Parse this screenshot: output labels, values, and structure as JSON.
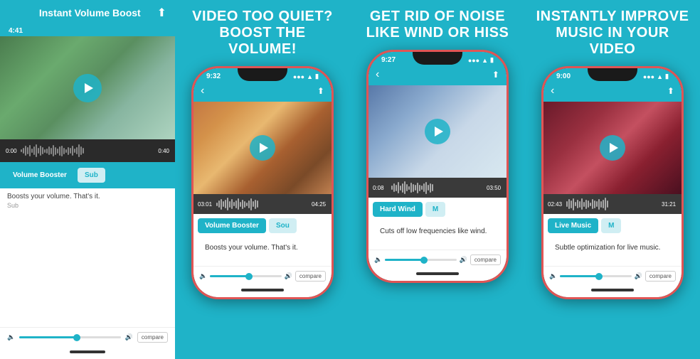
{
  "panels": [
    {
      "id": "panel-1",
      "header": "Instant Volume Boost",
      "time": "4:41",
      "show_back": false,
      "video_type": "waterfall",
      "waveform_start": "0:00",
      "waveform_end": "0:40",
      "filters": [
        {
          "label": "Volume Booster",
          "active": true
        },
        {
          "label": "Sub",
          "active": false
        }
      ],
      "description": "Boosts your volume. That's it.",
      "description_sub": "Sub"
    },
    {
      "id": "panel-2",
      "header": "VIDEO TOO QUIET? BOOST THE VOLUME!",
      "time": "9:32",
      "show_back": true,
      "video_type": "people",
      "waveform_start": "03:01",
      "waveform_end": "04:25",
      "filters": [
        {
          "label": "Volume Booster",
          "active": true
        },
        {
          "label": "Sou",
          "active": false
        }
      ],
      "description": "Boosts your volume. That's it.",
      "description_sub": ""
    },
    {
      "id": "panel-3",
      "header": "GET RID OF NOISE LIKE WIND OR HISS",
      "time": "9:27",
      "show_back": true,
      "video_type": "wind",
      "waveform_start": "0:08",
      "waveform_end": "03:50",
      "filters": [
        {
          "label": "Hard Wind",
          "active": true
        },
        {
          "label": "M",
          "active": false
        }
      ],
      "description": "Cuts off low frequencies like wind.",
      "description_sub": ""
    },
    {
      "id": "panel-4",
      "header": "INSTANTLY IMPROVE MUSIC IN YOUR VIDEO",
      "time": "9:00",
      "show_back": true,
      "video_type": "music",
      "waveform_start": "02:43",
      "waveform_end": "31:21",
      "filters": [
        {
          "label": "Live Music",
          "active": true
        },
        {
          "label": "M",
          "active": false
        }
      ],
      "description": "Subtle optimization for live music.",
      "description_sub": ""
    }
  ],
  "colors": {
    "teal": "#1fb3c8",
    "red_border": "#e05555",
    "dark": "#1a1a1a"
  },
  "icons": {
    "play": "▶",
    "back": "‹",
    "share": "⬆",
    "volume": "🔊",
    "compare": "compare"
  }
}
